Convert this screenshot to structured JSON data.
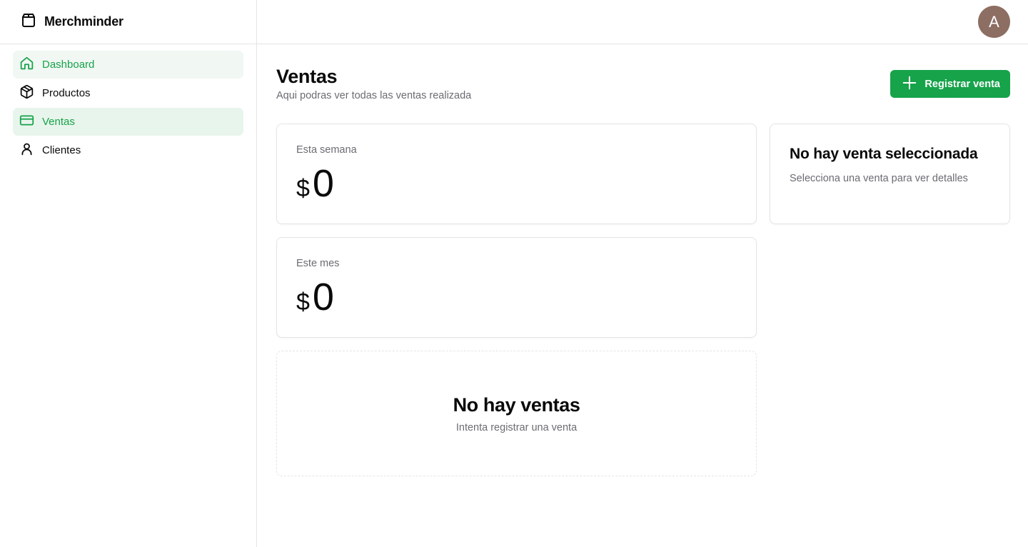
{
  "brand": {
    "name": "Merchminder",
    "icon": "package-box-icon"
  },
  "sidebar": {
    "items": [
      {
        "label": "Dashboard",
        "icon": "home-icon",
        "state": "hover"
      },
      {
        "label": "Productos",
        "icon": "cube-icon",
        "state": "normal"
      },
      {
        "label": "Ventas",
        "icon": "credit-card-icon",
        "state": "active"
      },
      {
        "label": "Clientes",
        "icon": "user-icon",
        "state": "normal"
      }
    ]
  },
  "topbar": {
    "avatar_initial": "A",
    "avatar_color": "#8d6e63"
  },
  "page": {
    "title": "Ventas",
    "subtitle": "Aqui podras ver todas las ventas realizada",
    "register_button": "Registrar venta"
  },
  "stats": [
    {
      "label": "Esta semana",
      "currency": "$",
      "amount": "0"
    },
    {
      "label": "Este mes",
      "currency": "$",
      "amount": "0"
    }
  ],
  "empty_state": {
    "title": "No hay ventas",
    "subtitle": "Intenta registrar una venta"
  },
  "detail_panel": {
    "title": "No hay venta seleccionada",
    "subtitle": "Selecciona una venta para ver detalles"
  },
  "colors": {
    "accent": "#16a34a",
    "active_bg": "#e8f5ec",
    "hover_bg": "#f1f7f3",
    "muted_text": "#6b6b73",
    "border": "#e4e4e7"
  }
}
